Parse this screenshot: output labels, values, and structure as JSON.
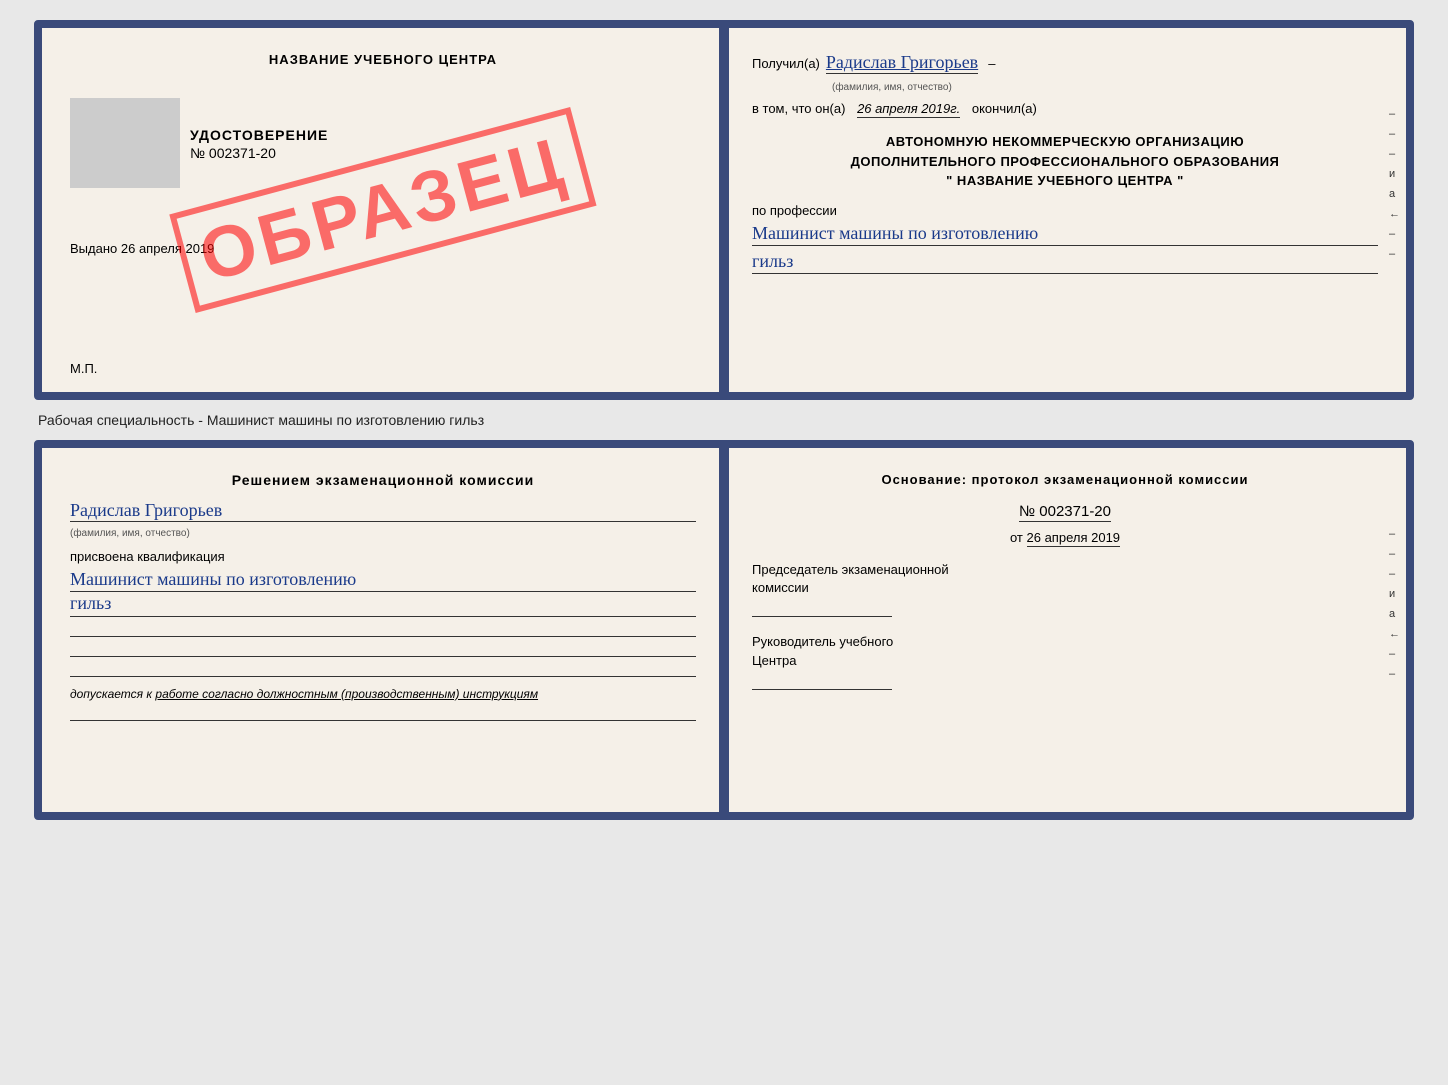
{
  "topCert": {
    "leftPanel": {
      "title": "НАЗВАНИЕ УЧЕБНОГО ЦЕНТРА",
      "udostoverenie": "УДОСТОВЕРЕНИЕ",
      "number": "№ 002371-20",
      "vydano": "Выдано",
      "vydanoDate": "26 апреля 2019",
      "mp": "М.П.",
      "obrazets": "ОБРАЗЕЦ"
    },
    "rightPanel": {
      "poluchilLabel": "Получил(а)",
      "name": "Радислав Григорьев",
      "nameCaption": "(фамилия, имя, отчество)",
      "vtomLabel": "в том, что он(а)",
      "date": "26 апреля 2019г.",
      "okonchilLabel": "окончил(а)",
      "org1": "АВТОНОМНУЮ НЕКОММЕРЧЕСКУЮ ОРГАНИЗАЦИЮ",
      "org2": "ДОПОЛНИТЕЛЬНОГО ПРОФЕССИОНАЛЬНОГО ОБРАЗОВАНИЯ",
      "orgName": "\"    НАЗВАНИЕ УЧЕБНОГО ЦЕНТРА    \"",
      "poProfessiiLabel": "по профессии",
      "profession1": "Машинист машины по изготовлению",
      "profession2": "гильз",
      "marks": [
        "–",
        "–",
        "–",
        "и",
        "а",
        "←",
        "–",
        "–"
      ]
    }
  },
  "specialtyLabel": "Рабочая специальность - Машинист машины по изготовлению гильз",
  "bottomDoc": {
    "leftPanel": {
      "title": "Решением  экзаменационной  комиссии",
      "name": "Радислав Григорьев",
      "nameCaption": "(фамилия, имя, отчество)",
      "prisvoena": "присвоена квалификация",
      "profession1": "Машинист  машины  по  изготовлению",
      "profession2": "гильз",
      "dopuskaetsya": "допускается к",
      "dopuskText": "работе согласно должностным (производственным) инструкциям"
    },
    "rightPanel": {
      "osnovanie": "Основание:  протокол  экзаменационной  комиссии",
      "number": "№  002371-20",
      "ot": "от",
      "date": "26 апреля 2019",
      "predsedatel1": "Председатель экзаменационной",
      "predsedatel2": "комиссии",
      "rukovoditel1": "Руководитель учебного",
      "rukovoditel2": "Центра",
      "marks": [
        "–",
        "–",
        "–",
        "и",
        "а",
        "←",
        "–",
        "–"
      ]
    }
  }
}
